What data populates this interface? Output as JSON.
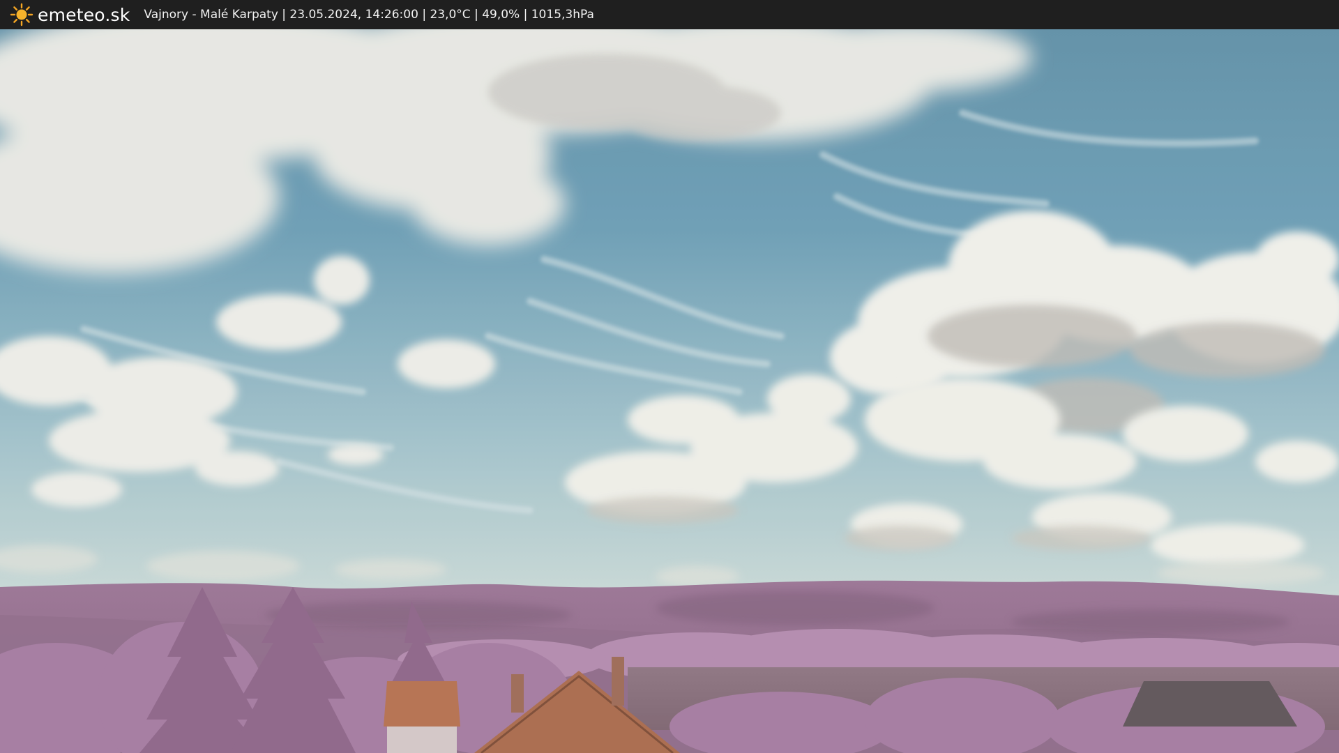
{
  "header": {
    "brand": "emeteo.sk",
    "caption": "Vajnory - Malé Karpaty | 23.05.2024, 14:26:00 | 23,0°C | 49,0% | 1015,3hPa",
    "logo_icon": "sun-icon"
  },
  "colors": {
    "bar_background": "#1f1f1f",
    "sun": "#f5a623",
    "sky": "#6f9fb5",
    "foliage": "#a77ea2",
    "roof": "#b5704f"
  }
}
